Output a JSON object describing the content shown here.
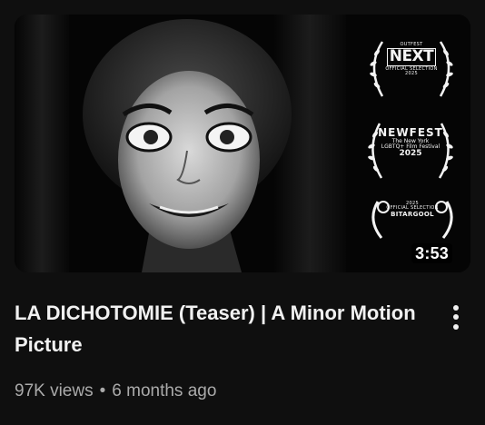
{
  "video": {
    "title": "LA DICHOTOMIE (Teaser) | A Minor Motion Picture",
    "views": "97K views",
    "separator": "•",
    "age": "6 months ago",
    "duration": "3:53"
  },
  "thumbnail": {
    "laurels": [
      {
        "top": "OUTFEST",
        "main": "NEXT",
        "line1": "OFFICIAL SELECTION",
        "line2": "2025"
      },
      {
        "main": "NEWFEST",
        "line1": "The New York",
        "line2": "LGBTQ+ Film Festival",
        "year": "2025"
      },
      {
        "top": "2025",
        "line1": "OFFICIAL SELECTION",
        "main": "BITARGOOL"
      }
    ]
  },
  "actions": {
    "more_icon": "more-vert-icon"
  }
}
